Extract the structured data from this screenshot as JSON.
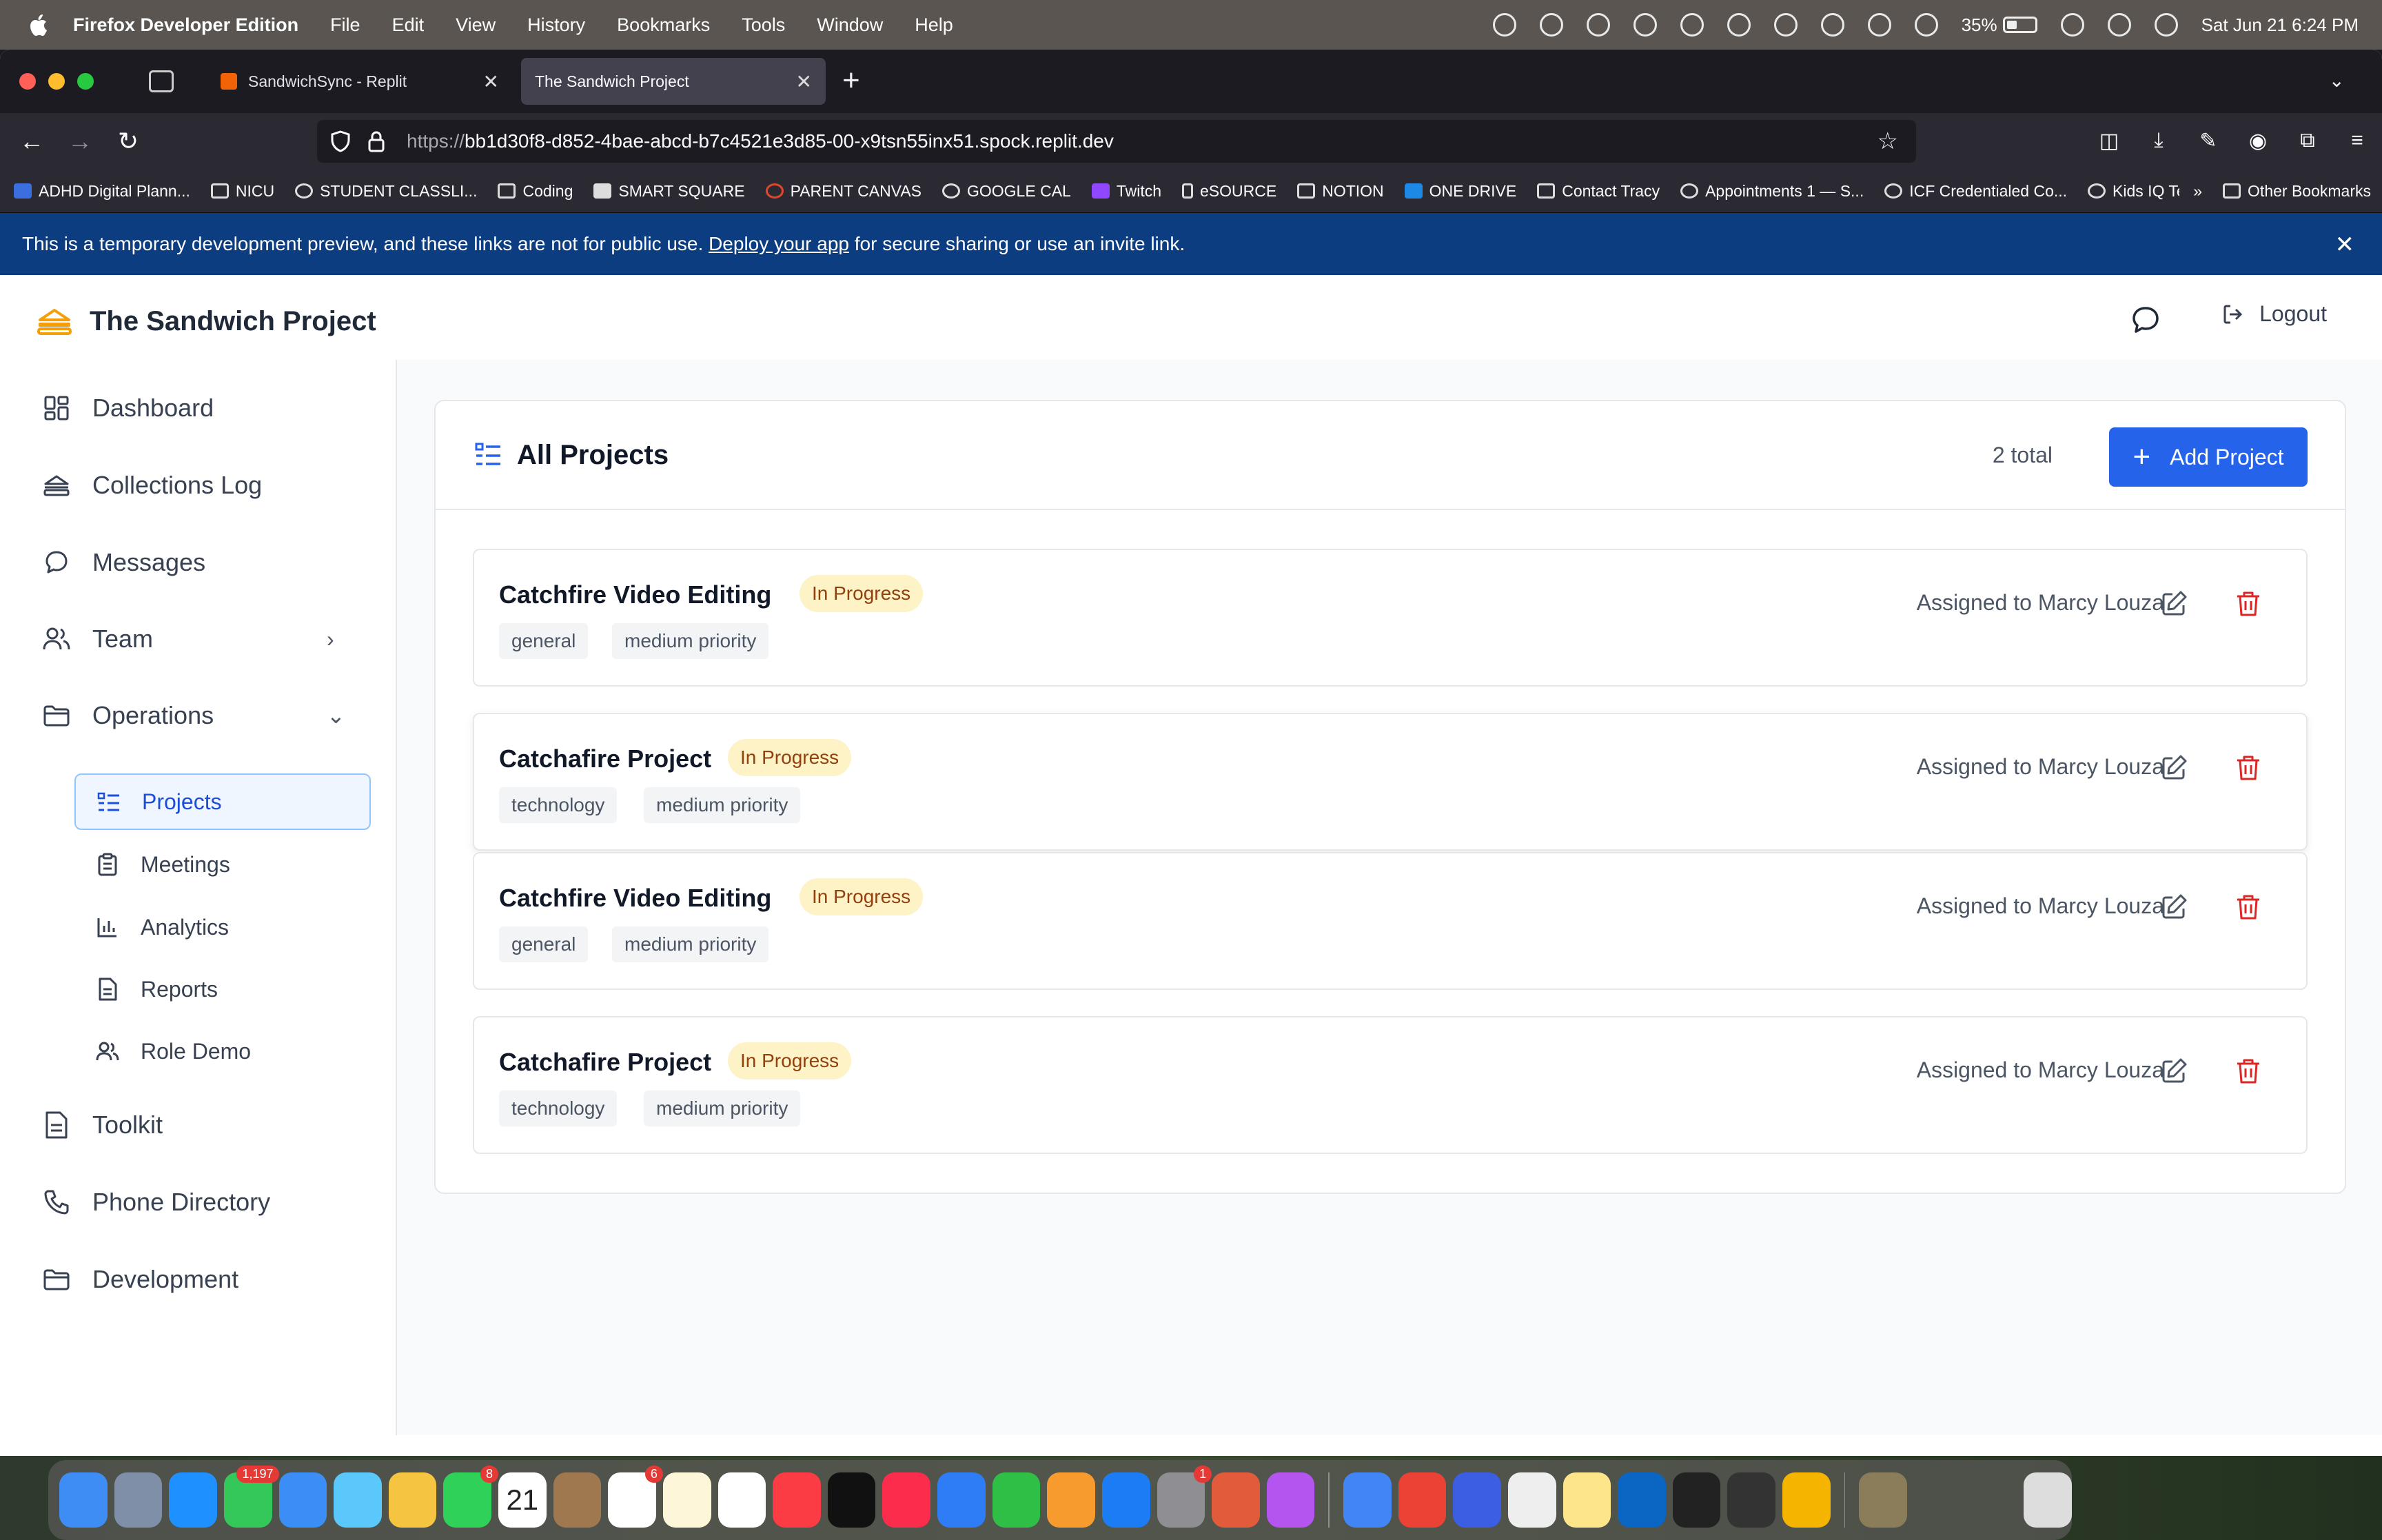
{
  "menubar": {
    "app_name": "Firefox Developer Edition",
    "menus": [
      "File",
      "Edit",
      "View",
      "History",
      "Bookmarks",
      "Tools",
      "Window",
      "Help"
    ],
    "battery": "35%",
    "datetime": "Sat Jun 21  6:24 PM"
  },
  "browser": {
    "tabs": [
      {
        "title": "SandwichSync - Replit",
        "active": false
      },
      {
        "title": "The Sandwich Project",
        "active": true
      }
    ],
    "url_proto": "https://",
    "url_rest": "bb1d30f8-d852-4bae-abcd-b7c4521e3d85-00-x9tsn55inx51.spock.replit.dev",
    "bookmarks": [
      "ADHD Digital Plann...",
      "NICU",
      "STUDENT CLASSLI...",
      "Coding",
      "SMART SQUARE",
      "PARENT CANVAS",
      "GOOGLE CAL",
      "Twitch",
      "eSOURCE",
      "NOTION",
      "ONE DRIVE",
      "Contact Tracy",
      "Appointments 1 — S...",
      "ICF Credentialed Co...",
      "Kids IQ Te:"
    ],
    "other_bookmarks": "Other Bookmarks",
    "banner": {
      "text_before": "This is a temporary development preview, and these links are not for public use. ",
      "link": "Deploy your app",
      "text_after": " for secure sharing or use an invite link."
    }
  },
  "app": {
    "title": "The Sandwich Project",
    "logout_label": "Logout",
    "brand_color": "#f59e0b",
    "accent_color": "#2563eb"
  },
  "sidebar": {
    "items": [
      {
        "label": "Dashboard",
        "icon": "dashboard-icon"
      },
      {
        "label": "Collections Log",
        "icon": "sandwich-icon"
      },
      {
        "label": "Messages",
        "icon": "chat-icon"
      },
      {
        "label": "Team",
        "icon": "users-icon"
      },
      {
        "label": "Operations",
        "icon": "folder-icon"
      },
      {
        "label": "Toolkit",
        "icon": "document-icon"
      },
      {
        "label": "Phone Directory",
        "icon": "phone-icon"
      },
      {
        "label": "Development",
        "icon": "folder-icon"
      }
    ],
    "operations_sub": [
      {
        "label": "Projects",
        "icon": "list-icon",
        "active": true
      },
      {
        "label": "Meetings",
        "icon": "clipboard-icon"
      },
      {
        "label": "Analytics",
        "icon": "bar-chart-icon"
      },
      {
        "label": "Reports",
        "icon": "document-icon"
      },
      {
        "label": "Role Demo",
        "icon": "users-icon"
      }
    ]
  },
  "projects_panel": {
    "title": "All Projects",
    "count": "2 total",
    "add_label": "Add Project",
    "projects": [
      {
        "name": "Catchfire Video Editing",
        "status": "In Progress",
        "tags": [
          "general",
          "medium priority"
        ],
        "assignee": "Assigned to Marcy Louza"
      },
      {
        "name": "Catchafire Project",
        "status": "In Progress",
        "tags": [
          "technology",
          "medium priority"
        ],
        "assignee": "Assigned to Marcy Louza"
      },
      {
        "name": "Catchfire Video Editing",
        "status": "In Progress",
        "tags": [
          "general",
          "medium priority"
        ],
        "assignee": "Assigned to Marcy Louza"
      },
      {
        "name": "Catchafire Project",
        "status": "In Progress",
        "tags": [
          "technology",
          "medium priority"
        ],
        "assignee": "Assigned to Marcy Louza"
      }
    ]
  },
  "dock": {
    "messages_badge": "1,197",
    "facetime_badge": "8",
    "reminders_badge": "6",
    "settings_badge": "1",
    "calendar_month": "JUN",
    "calendar_day": "21"
  }
}
